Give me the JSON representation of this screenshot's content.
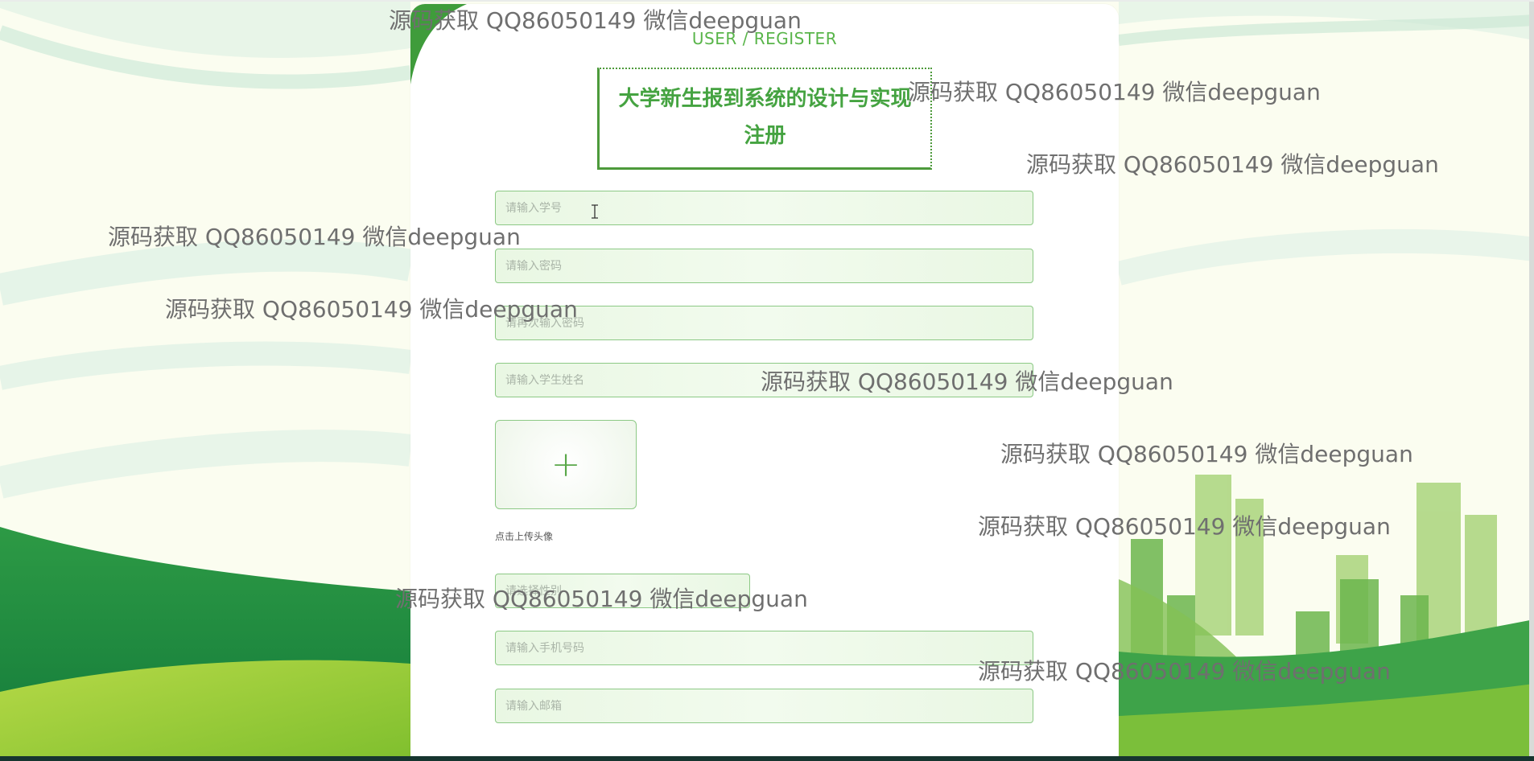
{
  "header": {
    "subtitle": "USER / REGISTER",
    "title": "大学新生报到系统的设计与实现",
    "subtitle_cn": "注册"
  },
  "form": {
    "student_id_placeholder": "请输入学号",
    "password_placeholder": "请输入密码",
    "confirm_password_placeholder": "请再次输入密码",
    "student_name_placeholder": "请输入学生姓名",
    "upload_plus": "+",
    "upload_label": "点击上传头像",
    "gender_placeholder": "请选择性别",
    "phone_placeholder": "请输入手机号码",
    "email_placeholder": "请输入邮箱"
  },
  "watermark": {
    "text": "源码获取 QQ86050149 微信deepguan"
  },
  "colors": {
    "accent": "#45a341",
    "field_border": "#8cc985",
    "field_bg": "#eef8ea"
  }
}
